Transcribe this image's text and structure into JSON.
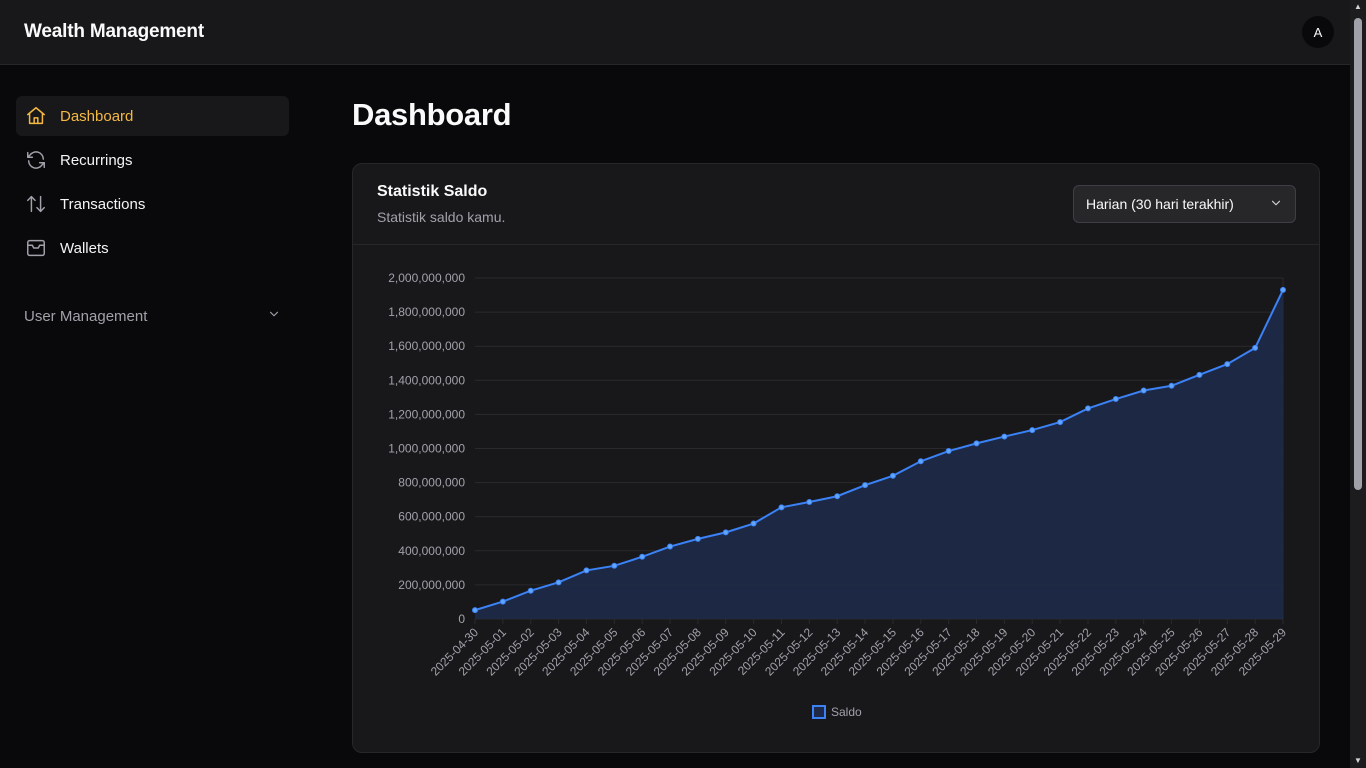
{
  "app": {
    "title": "Wealth Management",
    "avatar_initial": "A"
  },
  "sidebar": {
    "items": [
      {
        "label": "Dashboard",
        "icon": "home-icon",
        "active": true
      },
      {
        "label": "Recurrings",
        "icon": "refresh-icon"
      },
      {
        "label": "Transactions",
        "icon": "arrows-up-down-icon"
      },
      {
        "label": "Wallets",
        "icon": "wallet-icon"
      }
    ],
    "section": {
      "label": "User Management",
      "icon": "chevron-down-icon"
    }
  },
  "main": {
    "title": "Dashboard",
    "card": {
      "title": "Statistik Saldo",
      "subtitle": "Statistik saldo kamu.",
      "range_select": "Harian (30 hari terakhir)"
    }
  },
  "colors": {
    "accent": "#f5b942",
    "line": "#3b82f6",
    "area": "#1e2a47"
  },
  "chart_data": {
    "type": "area",
    "x": [
      "2025-04-30",
      "2025-05-01",
      "2025-05-02",
      "2025-05-03",
      "2025-05-04",
      "2025-05-05",
      "2025-05-06",
      "2025-05-07",
      "2025-05-08",
      "2025-05-09",
      "2025-05-10",
      "2025-05-11",
      "2025-05-12",
      "2025-05-13",
      "2025-05-14",
      "2025-05-15",
      "2025-05-16",
      "2025-05-17",
      "2025-05-18",
      "2025-05-19",
      "2025-05-20",
      "2025-05-21",
      "2025-05-22",
      "2025-05-23",
      "2025-05-24",
      "2025-05-25",
      "2025-05-26",
      "2025-05-27",
      "2025-05-28",
      "2025-05-29"
    ],
    "series": [
      {
        "name": "Saldo",
        "values": [
          52000000,
          102000000,
          166000000,
          215000000,
          285000000,
          312000000,
          365000000,
          425000000,
          470000000,
          508000000,
          560000000,
          655000000,
          686000000,
          720000000,
          785000000,
          840000000,
          925000000,
          985000000,
          1030000000,
          1070000000,
          1108000000,
          1155000000,
          1235000000,
          1290000000,
          1340000000,
          1368000000,
          1432000000,
          1495000000,
          1590000000,
          1930000000
        ]
      }
    ],
    "yticks": [
      "0",
      "200,000,000",
      "400,000,000",
      "600,000,000",
      "800,000,000",
      "1,000,000,000",
      "1,200,000,000",
      "1,400,000,000",
      "1,600,000,000",
      "1,800,000,000",
      "2,000,000,000"
    ],
    "ylim": [
      0,
      2000000000
    ],
    "grid": true,
    "legend": "bottom"
  }
}
